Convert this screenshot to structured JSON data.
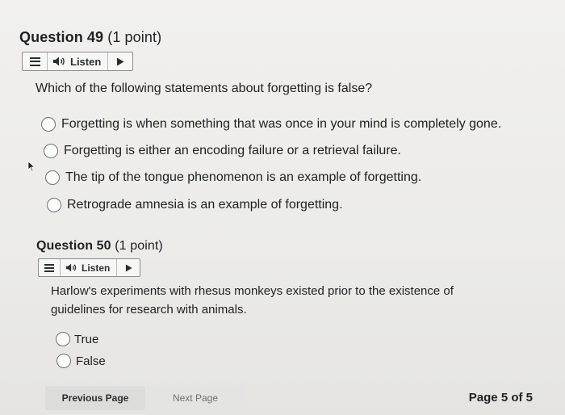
{
  "question49": {
    "title": "Question 49",
    "points": "(1 point)",
    "listen_label": "Listen",
    "prompt": "Which of the following statements about forgetting is false?",
    "options": [
      "Forgetting is when something that was once in your mind is completely gone.",
      "Forgetting is either an encoding failure or a retrieval failure.",
      "The tip of the tongue phenomenon is an example of forgetting.",
      "Retrograde amnesia is an example of forgetting."
    ]
  },
  "question50": {
    "title": "Question 50",
    "points": "(1 point)",
    "listen_label": "Listen",
    "prompt_line1": "Harlow's experiments with rhesus monkeys existed prior to the existence of",
    "prompt_line2": "guidelines for research with animals.",
    "options": [
      "True",
      "False"
    ]
  },
  "footer": {
    "previous_label": "Previous Page",
    "next_label": "Next Page",
    "page_indicator": "Page 5 of 5"
  },
  "icons": {
    "menu": "hamburger-icon",
    "speaker": "speaker-icon",
    "play": "play-icon",
    "cursor": "mouse-cursor-icon"
  },
  "colors": {
    "background": "#ecebe8",
    "text": "#1f2124",
    "button": "#dcdcda"
  }
}
